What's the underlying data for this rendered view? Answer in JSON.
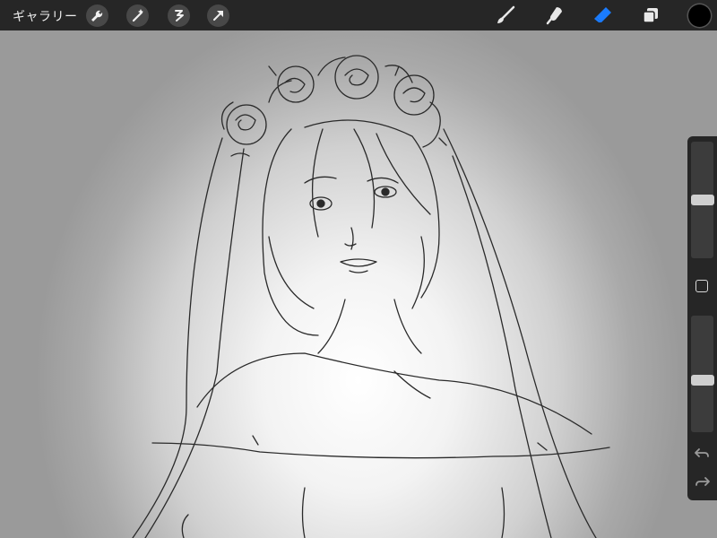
{
  "topbar": {
    "gallery_label": "ギャラリー",
    "left_tools": [
      "wrench-icon",
      "magic-wand-icon",
      "selection-icon",
      "transform-arrow-icon"
    ],
    "right_tools": [
      "brush-icon",
      "smudge-icon",
      "eraser-icon",
      "layers-icon"
    ],
    "active_tool": "eraser-icon",
    "active_color": "#1a7cff",
    "current_color": "#000000"
  },
  "sidebar": {
    "brush_size_level": 0.5,
    "opacity_level": 0.5,
    "buttons": [
      "modify-square-icon",
      "undo-icon",
      "redo-icon"
    ]
  },
  "canvas": {
    "description_icon": "sketch-canvas",
    "background_colors": [
      "#ffffff",
      "#9c9c9c"
    ]
  }
}
